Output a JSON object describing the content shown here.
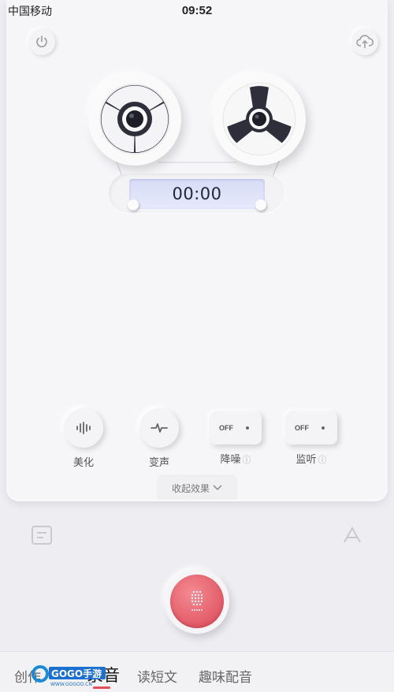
{
  "status_bar": {
    "carrier": "中国移动",
    "time": "09:52"
  },
  "header": {
    "power_icon": "power-icon",
    "upload_icon": "cloud-upload-icon"
  },
  "timer": {
    "value": "00:00"
  },
  "effects": [
    {
      "label": "美化",
      "icon": "waveform-icon"
    },
    {
      "label": "变声",
      "icon": "pulse-icon"
    },
    {
      "label": "降噪",
      "state": "OFF",
      "info": "ⓘ"
    },
    {
      "label": "监听",
      "state": "OFF",
      "info": "ⓘ"
    }
  ],
  "collapse": {
    "label": "收起效果"
  },
  "record": {
    "icon": "microphone-icon"
  },
  "tabs": [
    {
      "label": "创作"
    },
    {
      "label": "录音"
    },
    {
      "label": "读短文"
    },
    {
      "label": "趣味配音"
    }
  ],
  "watermark": {
    "logo_text": "GOGO手游",
    "url": "WWW.GOGOO.CN"
  },
  "colors": {
    "accent": "#e2505e",
    "timer_bg": "#dde1f8",
    "panel": "#f6f6f8"
  }
}
